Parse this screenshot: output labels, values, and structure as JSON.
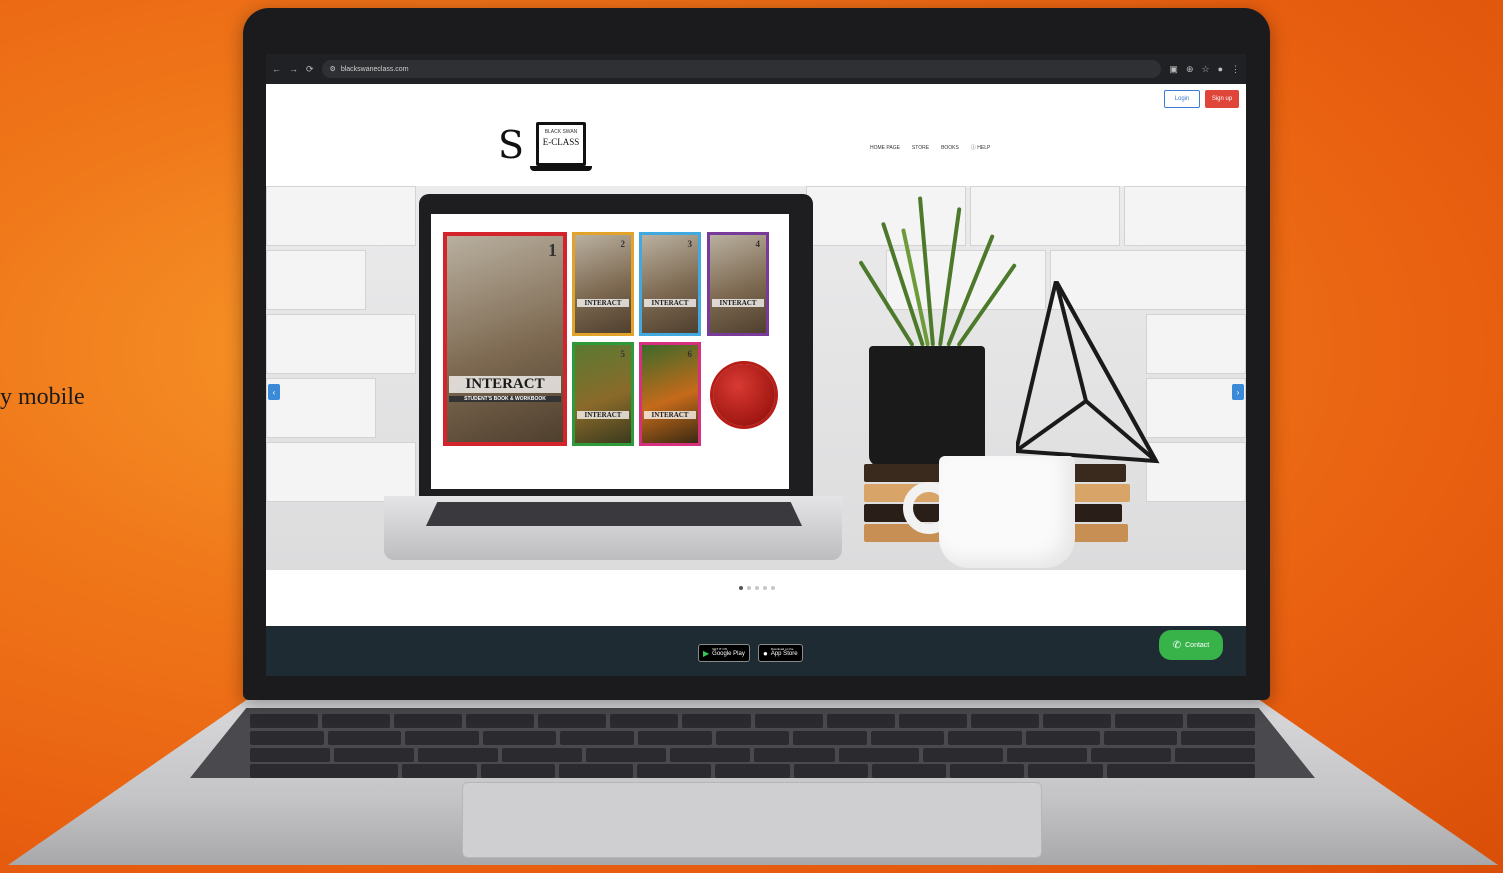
{
  "side_text": "y mobile",
  "browser": {
    "url": "blackswaneclass.com",
    "nav_icons": [
      "back-icon",
      "forward-icon",
      "reload-icon",
      "site-info-icon"
    ],
    "toolbar_icons": [
      "extension-icon",
      "zoom-icon",
      "star-icon",
      "profile-icon",
      "menu-icon"
    ]
  },
  "site": {
    "login_label": "Login",
    "signup_label": "Sign up",
    "logo": {
      "top_text": "BLACK SWAN",
      "main_text": "E-CLASS"
    },
    "nav": {
      "home": "HOME PAGE",
      "store": "STORE",
      "books": "BOOKS",
      "help": "HELP"
    }
  },
  "hero": {
    "covers": [
      {
        "title": "INTERACT",
        "number": "1",
        "subtitle": "STUDENT'S BOOK & WORKBOOK"
      },
      {
        "title": "INTERACT",
        "number": "2"
      },
      {
        "title": "INTERACT",
        "number": "3"
      },
      {
        "title": "INTERACT",
        "number": "4"
      },
      {
        "title": "INTERACT",
        "number": "5"
      },
      {
        "title": "INTERACT",
        "number": "6"
      }
    ],
    "prev_arrow": "‹",
    "next_arrow": "›",
    "slide_count": 5,
    "active_slide": 1
  },
  "footer": {
    "google_play": {
      "small": "GET IT ON",
      "big": "Google Play"
    },
    "app_store": {
      "small": "Download on the",
      "big": "App Store"
    },
    "contact_label": "Contact"
  }
}
